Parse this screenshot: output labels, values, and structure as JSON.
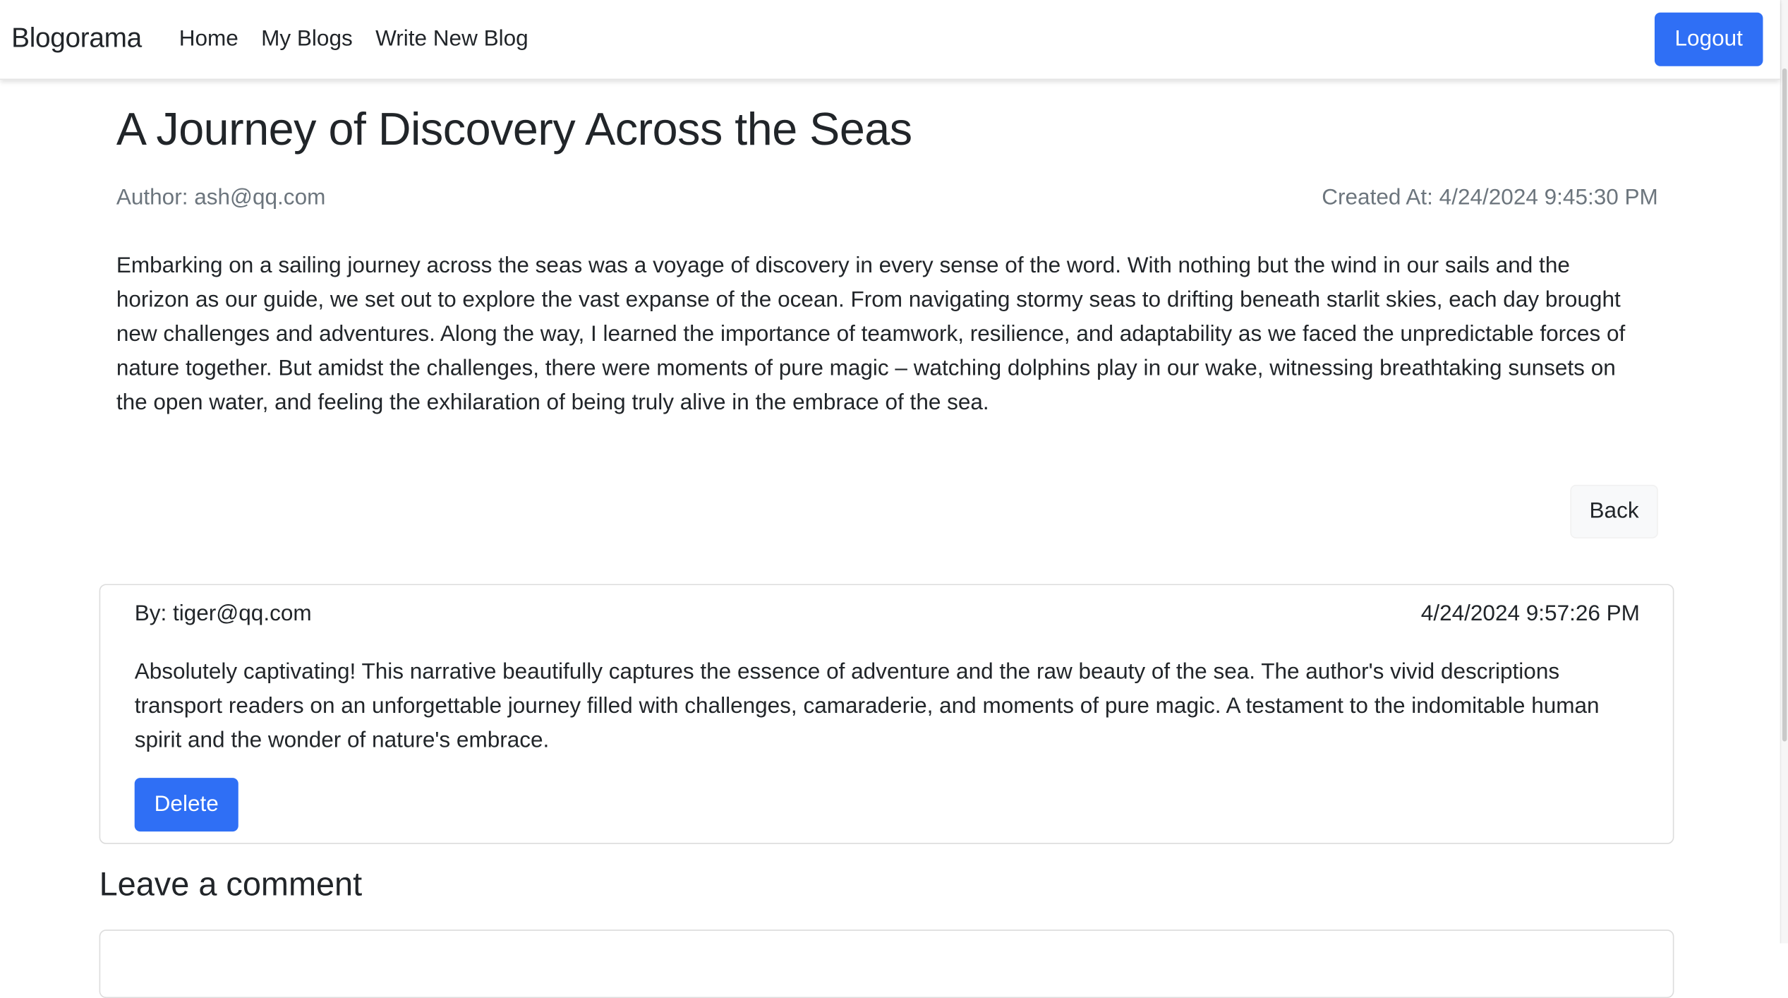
{
  "navbar": {
    "brand": "Blogorama",
    "links": [
      {
        "label": "Home"
      },
      {
        "label": "My Blogs"
      },
      {
        "label": "Write New Blog"
      }
    ],
    "logout_label": "Logout"
  },
  "post": {
    "title": "A Journey of Discovery Across the Seas",
    "author": "Author: ash@qq.com",
    "created_at": "Created At: 4/24/2024 9:45:30 PM",
    "body": "Embarking on a sailing journey across the seas was a voyage of discovery in every sense of the word. With nothing but the wind in our sails and the horizon as our guide, we set out to explore the vast expanse of the ocean. From navigating stormy seas to drifting beneath starlit skies, each day brought new challenges and adventures. Along the way, I learned the importance of teamwork, resilience, and adaptability as we faced the unpredictable forces of nature together. But amidst the challenges, there were moments of pure magic – watching dolphins play in our wake, witnessing breathtaking sunsets on the open water, and feeling the exhilaration of being truly alive in the embrace of the sea.",
    "back_label": "Back"
  },
  "comments": [
    {
      "by": "By: tiger@qq.com",
      "timestamp": "4/24/2024 9:57:26 PM",
      "text": "Absolutely captivating! This narrative beautifully captures the essence of adventure and the raw beauty of the sea. The author's vivid descriptions transport readers on an unforgettable journey filled with challenges, camaraderie, and moments of pure magic. A testament to the indomitable human spirit and the wonder of nature's embrace.",
      "delete_label": "Delete"
    }
  ],
  "leave_comment": {
    "heading": "Leave a comment"
  },
  "colors": {
    "primary": "#2f6ff5",
    "muted": "#6c757d",
    "text": "#212529"
  }
}
